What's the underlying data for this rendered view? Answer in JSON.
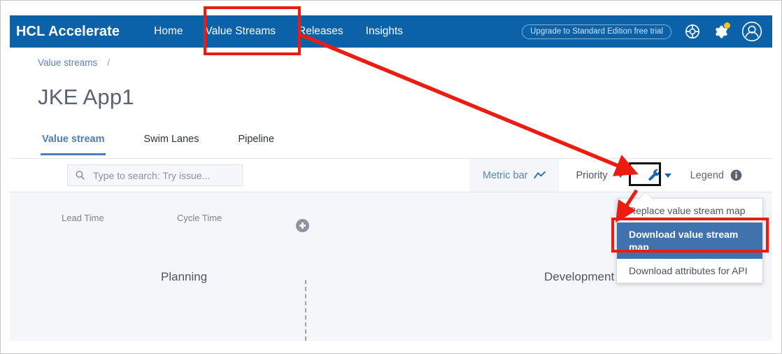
{
  "header": {
    "brand": "HCL Accelerate",
    "nav": [
      {
        "label": "Home",
        "name": "nav-home"
      },
      {
        "label": "Value Streams",
        "name": "nav-value-streams"
      },
      {
        "label": "Releases",
        "name": "nav-releases"
      },
      {
        "label": "Insights",
        "name": "nav-insights"
      }
    ],
    "upgrade_label": "Upgrade to Standard Edition free trial",
    "icons": {
      "help": "lifebuoy-icon",
      "settings": "gear-icon",
      "account": "user-avatar-icon"
    },
    "background_color": "#0c62a8"
  },
  "breadcrumb": {
    "root": "Value streams",
    "separator": "/"
  },
  "page": {
    "title": "JKE App1"
  },
  "tabs": [
    {
      "label": "Value stream",
      "name": "tab-value-stream",
      "active": true
    },
    {
      "label": "Swim Lanes",
      "name": "tab-swim-lanes",
      "active": false
    },
    {
      "label": "Pipeline",
      "name": "tab-pipeline",
      "active": false
    }
  ],
  "toolbar": {
    "search_placeholder": "Type to search: Try issue...",
    "search_value": "",
    "metric_bar_label": "Metric bar",
    "priority_label": "Priority",
    "legend_label": "Legend",
    "wrench_icon": "wrench-icon"
  },
  "dropdown": {
    "items": [
      {
        "label": "Replace value stream map",
        "name": "menu-replace-value-stream-map",
        "selected": false
      },
      {
        "label": "Download value stream map",
        "name": "menu-download-value-stream-map",
        "selected": true
      },
      {
        "label": "Download attributes for API",
        "name": "menu-download-attributes-for-api",
        "selected": false
      }
    ],
    "highlight_color": "#4072ae"
  },
  "canvas": {
    "lead_time_label": "Lead Time",
    "cycle_time_label": "Cycle Time",
    "stages": [
      {
        "label": "Planning",
        "name": "stage-planning"
      },
      {
        "label": "Development",
        "name": "stage-development"
      }
    ],
    "add_node_icon": "plus-circle-icon",
    "background_color": "#f4f6fa"
  },
  "annotations": {
    "highlight_color": "#ee1b11",
    "boxes": [
      {
        "name": "annotation-box-value-streams-nav"
      },
      {
        "name": "annotation-box-wrench-button"
      },
      {
        "name": "annotation-box-download-value-stream-map"
      }
    ],
    "arrows": [
      {
        "name": "annotation-arrow-nav-to-wrench"
      },
      {
        "name": "annotation-arrow-wrench-to-menu"
      }
    ]
  }
}
